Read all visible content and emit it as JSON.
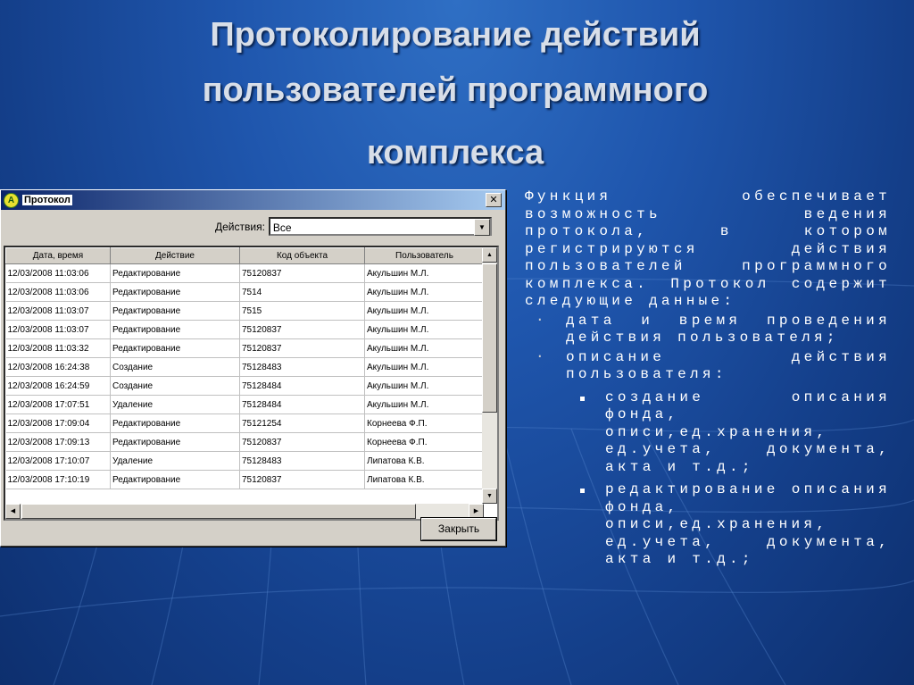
{
  "slide": {
    "title_lines": [
      "Протоколирование действий",
      "пользователей программного",
      "комплекса"
    ]
  },
  "window": {
    "title": "Протокол",
    "filter_label": "Действия:",
    "filter_value": "Все",
    "close_button": "Закрыть",
    "columns": [
      "Дата, время",
      "Действие",
      "Код объекта",
      "Пользователь"
    ],
    "rows": [
      [
        "12/03/2008 11:03:06",
        "Редактирование",
        "75120837",
        "Акульшин М.Л."
      ],
      [
        "12/03/2008 11:03:06",
        "Редактирование",
        "7514",
        "Акульшин М.Л."
      ],
      [
        "12/03/2008 11:03:07",
        "Редактирование",
        "7515",
        "Акульшин М.Л."
      ],
      [
        "12/03/2008 11:03:07",
        "Редактирование",
        "75120837",
        "Акульшин М.Л."
      ],
      [
        "12/03/2008 11:03:32",
        "Редактирование",
        "75120837",
        "Акульшин М.Л."
      ],
      [
        "12/03/2008 16:24:38",
        "Создание",
        "75128483",
        "Акульшин М.Л."
      ],
      [
        "12/03/2008 16:24:59",
        "Создание",
        "75128484",
        "Акульшин М.Л."
      ],
      [
        "12/03/2008 17:07:51",
        "Удаление",
        "75128484",
        "Акульшин М.Л."
      ],
      [
        "12/03/2008 17:09:04",
        "Редактирование",
        "75121254",
        "Корнеева Ф.П."
      ],
      [
        "12/03/2008 17:09:13",
        "Редактирование",
        "75120837",
        "Корнеева Ф.П."
      ],
      [
        "12/03/2008 17:10:07",
        "Удаление",
        "75128483",
        "Липатова К.В."
      ],
      [
        "12/03/2008 17:10:19",
        "Редактирование",
        "75120837",
        "Липатова К.В."
      ]
    ]
  },
  "text": {
    "intro": "Функция обеспечивает возможность ведения протокола, в котором регистрируются действия пользователей программного комплекса. Протокол содержит следующие данные:",
    "bullet1": "дата и время проведения действия пользователя;",
    "bullet2": "описание действия пользователя:",
    "sub1": "создание описания фонда, описи,ед.хранения, ед.учета, документа, акта и т.д.;",
    "sub2": "редактирование описания фонда, описи,ед.хранения, ед.учета, документа, акта и т.д.;"
  }
}
